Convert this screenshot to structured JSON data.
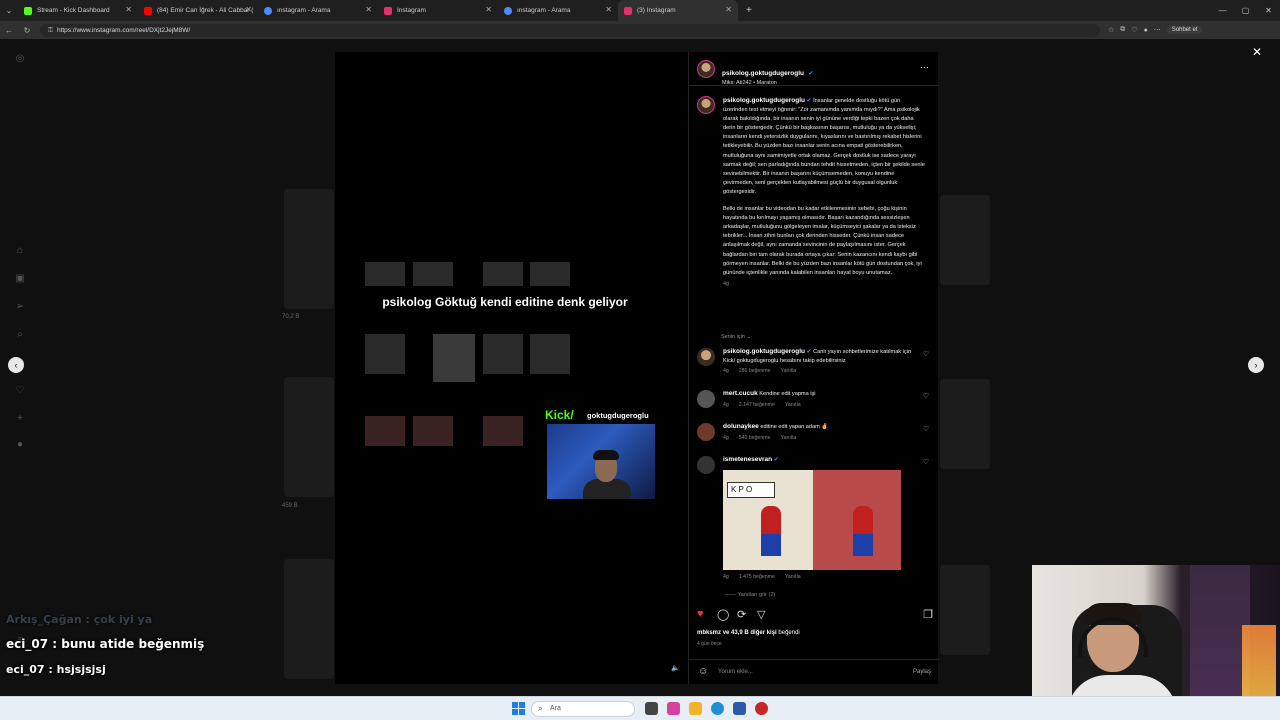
{
  "browser": {
    "tabs": [
      {
        "label": "Stream - Kick Dashboard",
        "color": "#53fc18",
        "active": false
      },
      {
        "label": "(84) Emir Can İğrek - Ali Cabbar (",
        "color": "#ff0000",
        "active": false
      },
      {
        "label": "ınstagram - Arama",
        "color": "#4a8cff",
        "active": false
      },
      {
        "label": "Instagram",
        "color": "#e1306c",
        "active": false
      },
      {
        "label": "ınstagram - Arama",
        "color": "#4a8cff",
        "active": false
      },
      {
        "label": "(3) Instagram",
        "color": "#e1306c",
        "active": true
      }
    ],
    "url": "https://www.instagram.com/reel/DXjt2JejM8W/",
    "chat_button": "Sohbet et"
  },
  "background": {
    "views_1": "70,2 B",
    "views_2": "459 B"
  },
  "reel": {
    "overlay_title": "psikolog Göktuğ kendi editine denk geliyor",
    "kick_label": "Kick/",
    "kick_name": "goktugdugeroglu"
  },
  "post": {
    "username": "psikolog.goktugdugeroglu",
    "audio": "Miks: Ati242 • Maraton",
    "caption_user": "psikolog.goktugdugeroglu",
    "caption_p1": "İnsanlar genelde dostluğu kötü gün üzerinden test etmeyi öğrenir: \"Zor zamanımda yanımda mıydı?\" Ama psikolojik olarak bakıldığında, bir insanın senin iyi gününe verdiği tepki bazen çok daha derin bir göstergedir. Çünkü bir başkasının başarısı, mutluluğu ya da yükselişi; insanların kendi yetersizlik duygularını, kıyaslarını ve bastırılmış rekabet hislerini tetikleyebilir. Bu yüzden bazı insanlar senin acına empati gösterebilirken, mutluluğuna aynı samimiyetle ortak olamaz. Gerçek dostluk ise sadece yarayı sarmak değil; sen parladığında bundan tehdit hissetmeden, içten bir şekilde senle sevinebilmektir. Bir insanın başarını küçümsemeden, konuyu kendine çevirmeden, seni gerçekten kutlayabilmesi güçlü bir duygusal olgunluk göstergesidir.",
    "caption_p2": "Belki de insanlar bu videodan bu kadar etkilenmesinin sebebi, çoğu kişinin hayatında bu kırılmayı yaşamış olmasıdır. Başarı kazandığında sessizleşen arkadaşlar, mutluluğunu gölgeleyen imalar, küçümseyici şakalar ya da isteksiz tebrikler... İnsan zihni bunları çok derinden hisseder. Çünkü insan sadece anlaşılmak değil, aynı zamanda sevincinin de paylaşılmasını ister. Gerçek bağlardan biri tam olarak burada ortaya çıkar: Senin kazancını kendi kaybı gibi görmeyen insanlar. Belki de bu yüzden bazı insanlar kötü gün dostundan çok, iyi gününde içtenlikle yanında kalabilen insanları hayat boyu unutamaz.",
    "caption_age": "4g",
    "for_you": "Senin için",
    "comments": [
      {
        "user": "psikolog.goktugdugeroglu",
        "verified": true,
        "text": "Canlı yayın sohbetlerimize katılmak için Kick/ goktugdugeroglu hesabını takip edebilirsiniz",
        "age": "4g",
        "likes": "286 beğenme",
        "reply": "Yanıtla"
      },
      {
        "user": "mert.cucuk",
        "verified": false,
        "text": "Kendine edit yapma işi",
        "age": "4g",
        "likes": "2.147 beğenme",
        "reply": "Yanıtla"
      },
      {
        "user": "dolunaykee",
        "verified": false,
        "text": "editine edit yapan adam ✌",
        "age": "4g",
        "likes": "540 beğenme",
        "reply": "Yanıtla"
      },
      {
        "user": "ismetenesevran",
        "verified": true,
        "text": "",
        "age": "4g",
        "likes": "1.475 beğenme",
        "reply": "Yanıtla"
      }
    ],
    "gif_sign": "K P O",
    "view_replies": "Yanıtları gör (2)",
    "liked_by_user": "mbksmz",
    "liked_by_rest": "ve 43,9 B diğer kişi",
    "liked_suffix": "beğendi",
    "date": "4 gün önce",
    "comment_placeholder": "Yorum ekle...",
    "share": "Paylaş"
  },
  "stream_chat": [
    {
      "user": "Arkış_Çağan",
      "text": ": çok iyi ya"
    },
    {
      "user": "eci_07",
      "text": ": bunu atide beğenmiş"
    },
    {
      "user": "eci_07",
      "text": ": hsjsjsjsj"
    }
  ],
  "taskbar": {
    "search": "Ara"
  }
}
